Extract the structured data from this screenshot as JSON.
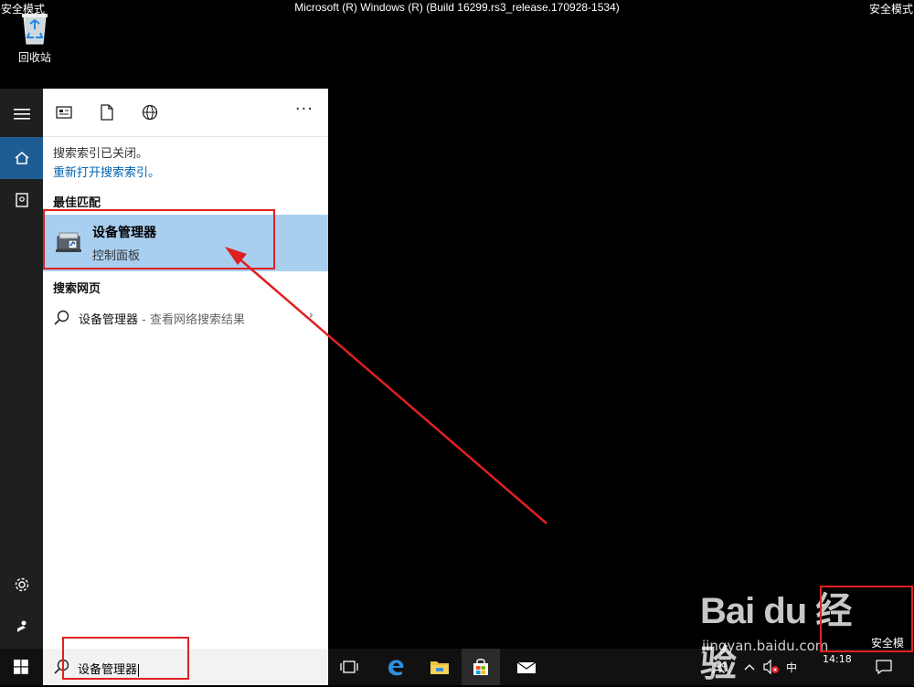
{
  "window": {
    "title": "Microsoft (R) Windows (R) (Build 16299.rs3_release.170928-1534)",
    "safe_mode_label": "安全模式"
  },
  "desktop": {
    "recycle_bin_label": "回收站"
  },
  "search_panel": {
    "notice": "搜索索引已关闭。",
    "reopen_link": "重新打开搜索索引。",
    "best_match_title": "最佳匹配",
    "best_match": {
      "name": "设备管理器",
      "subtitle": "控制面板"
    },
    "web_title": "搜索网页",
    "web_result": {
      "query": "设备管理器",
      "hint": " - 查看网络搜索结果"
    },
    "more_label": "···"
  },
  "taskbar": {
    "search_value": "设备管理器",
    "ime": "中",
    "time": "14:18"
  },
  "watermark": {
    "logo": "Bai du 经验",
    "url": "jingyan.baidu.com"
  },
  "colors": {
    "accent": "#1e5c93",
    "selection": "#a9cff0",
    "link": "#0063b1",
    "annotation": "#e02020"
  }
}
